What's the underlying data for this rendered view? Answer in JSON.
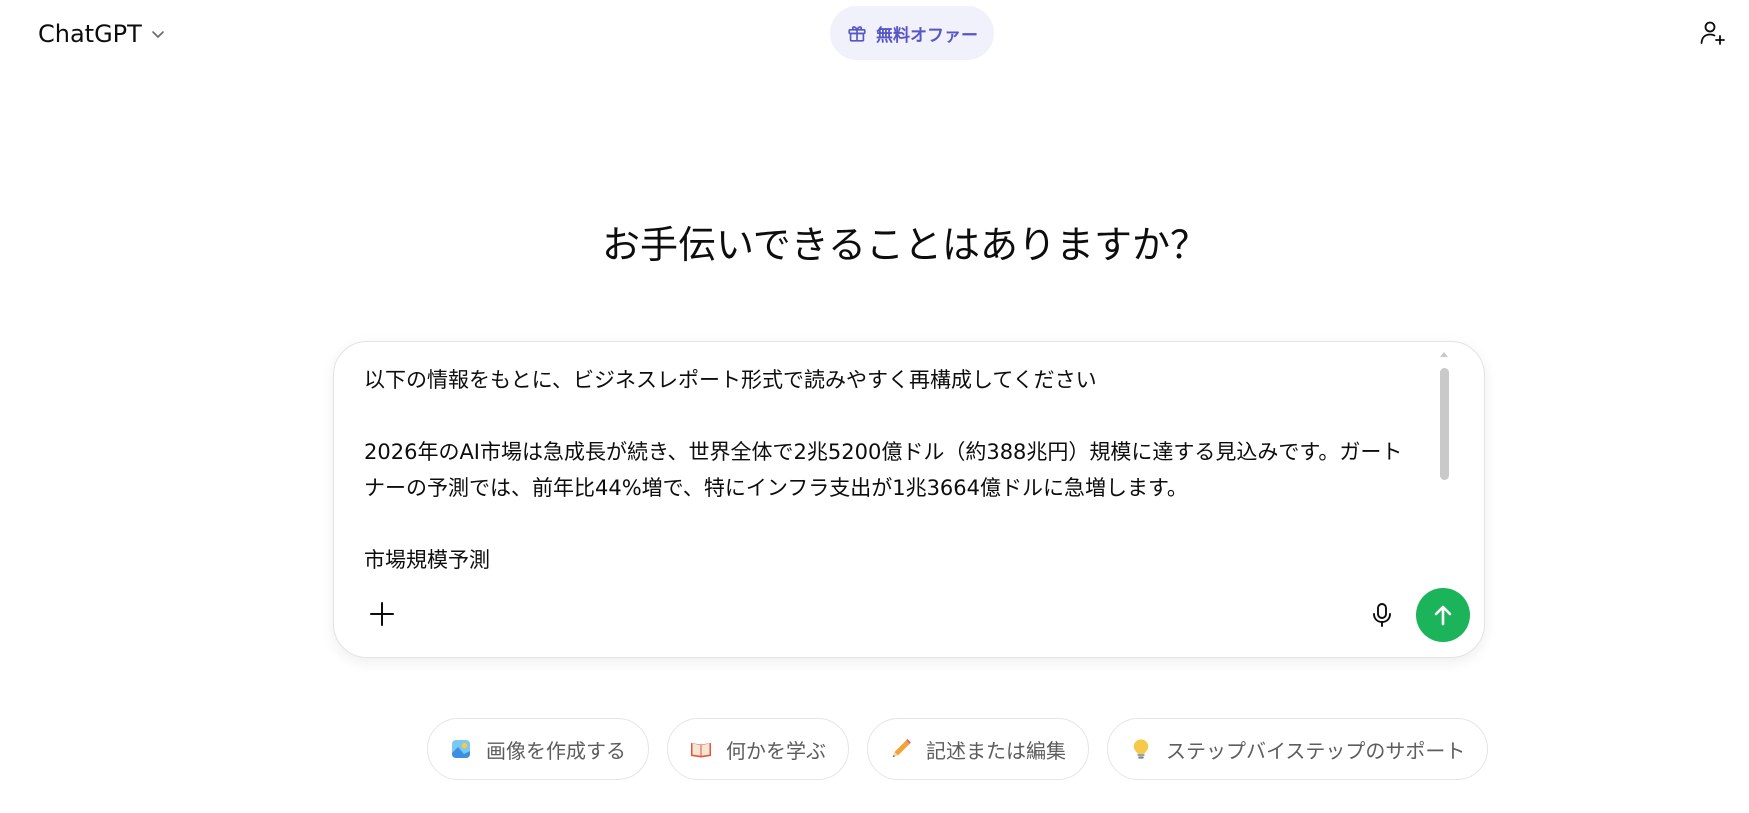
{
  "header": {
    "model_name": "ChatGPT",
    "offer_label": "無料オファー"
  },
  "main": {
    "headline": "お手伝いできることはありますか？"
  },
  "composer": {
    "lines": [
      "以下の情報をもとに、ビジネスレポート形式で読みやすく再構成してください",
      "",
      "2026年のAI市場は急成長が続き、世界全体で2兆5200億ドル（約388兆円）規模に達する見込みです。ガート",
      "ナーの予測では、前年比44%増で、特にインフラ支出が1兆3664億ドルに急増します。",
      "",
      "市場規模予測"
    ]
  },
  "suggestions": [
    {
      "label": "画像を作成する",
      "icon": "image-icon"
    },
    {
      "label": "何かを学ぶ",
      "icon": "book-icon"
    },
    {
      "label": "記述または編集",
      "icon": "pencil-icon"
    },
    {
      "label": "ステップバイステップのサポート",
      "icon": "lightbulb-icon"
    }
  ],
  "colors": {
    "accent_green": "#1bb45a",
    "offer_bg": "#f1f1fb",
    "offer_text": "#5856c7",
    "chip_text": "#5d5d5d"
  }
}
